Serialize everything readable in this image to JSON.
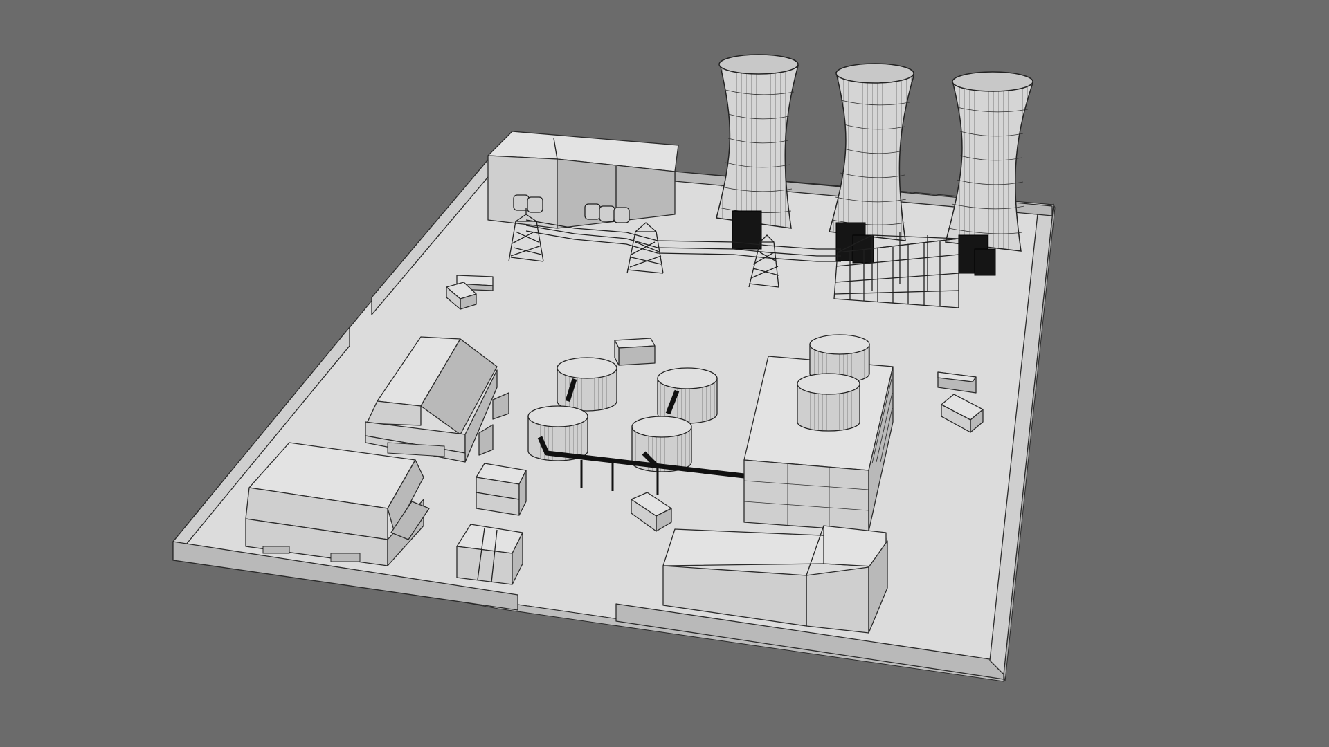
{
  "scene": {
    "subject": "",
    "render_style": "clay-wireframe",
    "background_color": "#6b6b6b",
    "ground_color": "#dcdcdc",
    "wire_color": "#202020"
  }
}
